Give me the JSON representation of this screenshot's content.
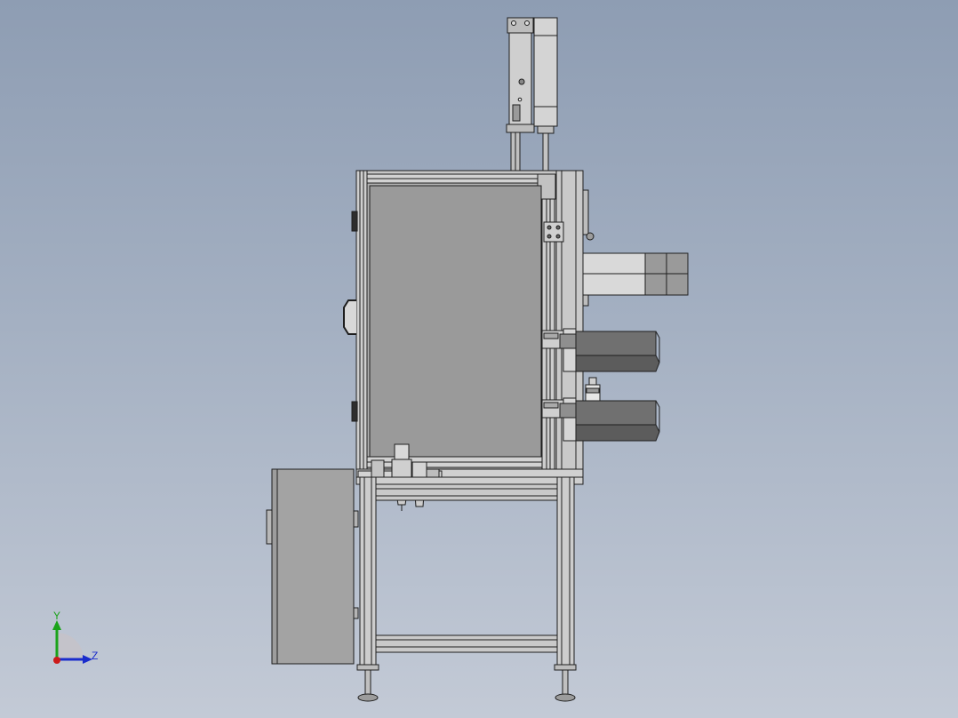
{
  "colors": {
    "background_top": "#8e9db3",
    "background_bottom": "#c3cad6",
    "panel_fill": "#9a9a9a",
    "frame_fill": "#c6c6c6",
    "outline": "#1e1e1e",
    "dark_block": "#6e6e6e",
    "axis_y": "#1aa31a",
    "axis_z": "#1a2ccc",
    "axis_x": "#cc1a1a"
  },
  "triad": {
    "y_label": "Y",
    "z_label": "Z"
  }
}
